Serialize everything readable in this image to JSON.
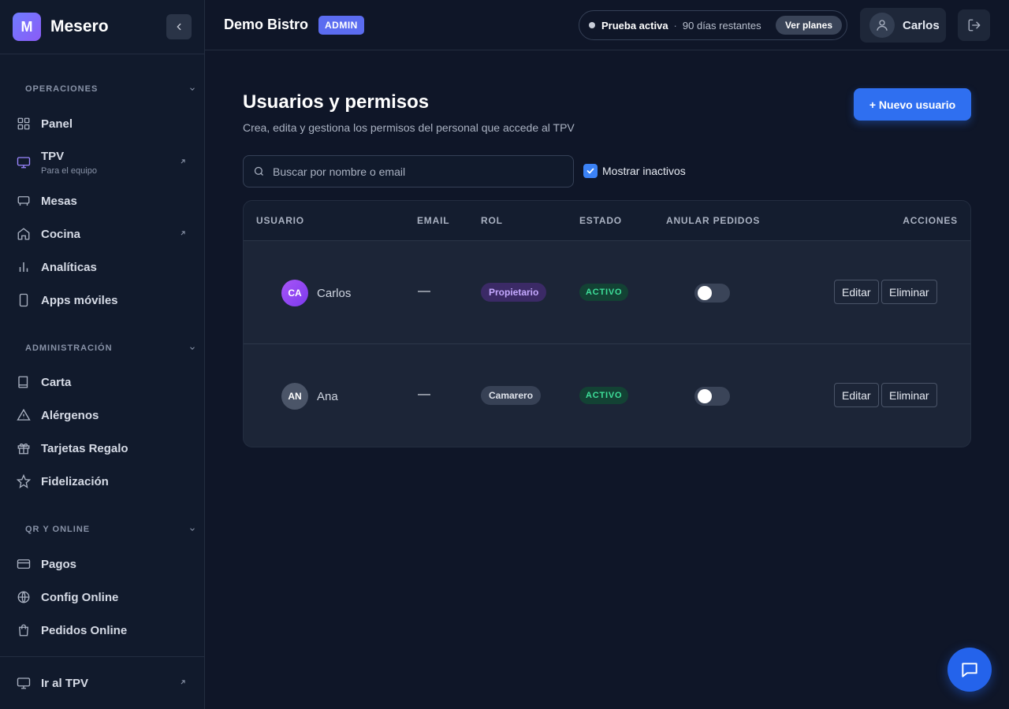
{
  "brand": {
    "logo_letter": "M",
    "name": "Mesero"
  },
  "sidebar": {
    "sections": [
      {
        "title": "OPERACIONES"
      },
      {
        "title": "ADMINISTRACIÓN"
      },
      {
        "title": "QR Y ONLINE"
      }
    ],
    "items": [
      {
        "label": "Panel",
        "icon": "grid-icon"
      },
      {
        "label": "TPV",
        "sub": "Para el equipo",
        "icon": "monitor-icon",
        "external": true
      },
      {
        "label": "Mesas",
        "icon": "table-icon"
      },
      {
        "label": "Cocina",
        "icon": "home-icon",
        "external": true
      },
      {
        "label": "Analíticas",
        "icon": "bar-chart-icon"
      },
      {
        "label": "Apps móviles",
        "icon": "phone-icon"
      },
      {
        "label": "Carta",
        "icon": "book-icon"
      },
      {
        "label": "Alérgenos",
        "icon": "warning-icon"
      },
      {
        "label": "Tarjetas Regalo",
        "icon": "gift-icon"
      },
      {
        "label": "Fidelización",
        "icon": "star-icon"
      },
      {
        "label": "Pagos",
        "icon": "credit-card-icon"
      },
      {
        "label": "Config Online",
        "icon": "globe-icon"
      },
      {
        "label": "Pedidos Online",
        "icon": "shopping-bag-icon"
      }
    ],
    "footer": {
      "label": "Ir al TPV",
      "icon": "monitor-icon"
    }
  },
  "topbar": {
    "business": "Demo Bistro",
    "badge": "ADMIN",
    "trial": {
      "status": "Prueba activa",
      "separator": "·",
      "remaining": "90 días restantes",
      "plans_label": "Ver planes"
    },
    "user": "Carlos"
  },
  "main": {
    "title": "Usuarios y permisos",
    "subtitle": "Crea, edita y gestiona los permisos del personal que accede al TPV",
    "new_user_label": "+ Nuevo usuario",
    "search_placeholder": "Buscar por nombre o email",
    "show_inactive_label": "Mostrar inactivos",
    "show_inactive_checked": true,
    "table": {
      "headers": {
        "user": "USUARIO",
        "email": "EMAIL",
        "role": "ROL",
        "status": "ESTADO",
        "cancel": "ANULAR PEDIDOS",
        "actions": "ACCIONES"
      },
      "rows": [
        {
          "initials": "CA",
          "name": "Carlos",
          "email": "—",
          "role": "Propietario",
          "status": "ACTIVO",
          "anular": false,
          "edit": "Editar",
          "delete": "Eliminar"
        },
        {
          "initials": "AN",
          "name": "Ana",
          "email": "—",
          "role": "Camarero",
          "status": "ACTIVO",
          "anular": false,
          "edit": "Editar",
          "delete": "Eliminar"
        }
      ]
    }
  },
  "colors": {
    "accent": "#2f6ff0",
    "status_active": "#3ee09a",
    "owner_role": "#c4a8ff"
  }
}
